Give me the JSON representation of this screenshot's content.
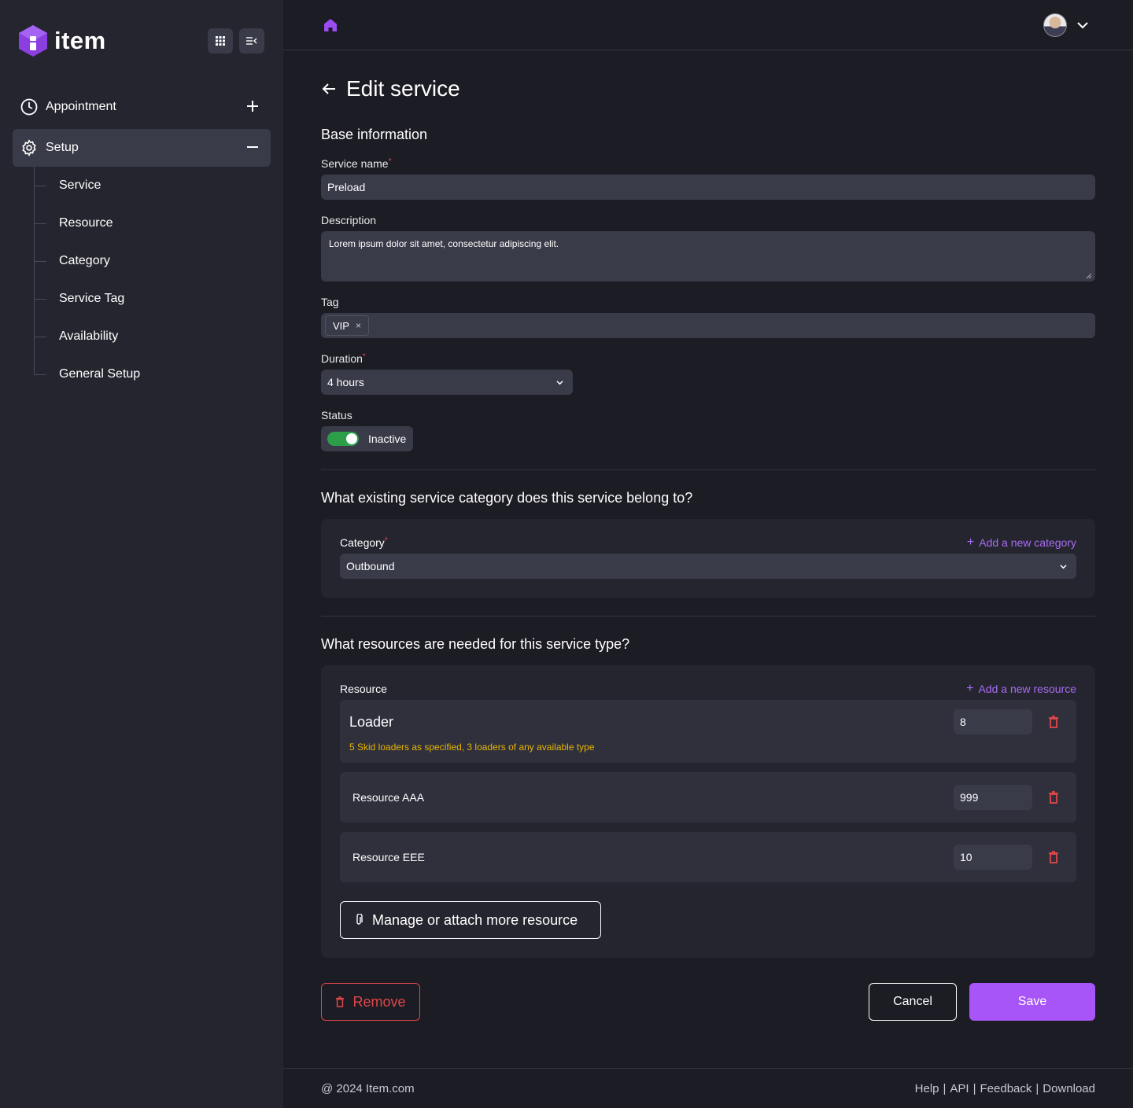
{
  "app": {
    "logo_text": "item"
  },
  "sidebar": {
    "items": [
      {
        "label": "Appointment",
        "action": "+"
      },
      {
        "label": "Setup",
        "action": "−"
      }
    ],
    "sub_items": [
      {
        "label": "Service"
      },
      {
        "label": "Resource"
      },
      {
        "label": "Category"
      },
      {
        "label": "Service Tag"
      },
      {
        "label": "Availability"
      },
      {
        "label": "General Setup"
      }
    ]
  },
  "page": {
    "title": "Edit service"
  },
  "base": {
    "section_title": "Base information",
    "service_name": {
      "label": "Service name",
      "required_mark": "*",
      "value": "Preload"
    },
    "description": {
      "label": "Description",
      "value": "Lorem ipsum dolor sit amet, consectetur adipiscing elit."
    },
    "tag": {
      "label": "Tag",
      "chips": [
        "VIP"
      ],
      "remove_glyph": "×"
    },
    "duration": {
      "label": "Duration",
      "required_mark": "*",
      "value": "4 hours"
    },
    "status": {
      "label": "Status",
      "value": "Inactive",
      "toggle_on": true
    }
  },
  "category_section": {
    "question": "What existing service category does this service belong to?",
    "label": "Category",
    "required_mark": "*",
    "add_link": "Add a new category",
    "value": "Outbound"
  },
  "resource_section": {
    "question": "What resources are needed for this service type?",
    "label": "Resource",
    "add_link": "Add a new resource",
    "rows": [
      {
        "name": "Loader",
        "note": "5 Skid loaders as specified, 3 loaders of any available type",
        "qty": "8"
      },
      {
        "name": "Resource AAA",
        "qty": "999"
      },
      {
        "name": "Resource EEE",
        "qty": "10"
      }
    ],
    "manage_button": "Manage or attach more resource"
  },
  "actions": {
    "remove": "Remove",
    "cancel": "Cancel",
    "save": "Save"
  },
  "footer": {
    "copyright": "@ 2024 Item.com",
    "links": [
      "Help",
      "API",
      "Feedback",
      "Download"
    ],
    "separator": "|"
  },
  "colors": {
    "accent": "#a855f7",
    "danger": "#e0474a",
    "toggle_on": "#2c9e4a",
    "note": "#e6b400"
  },
  "icons": [
    "logo-icon",
    "apps-grid-icon",
    "collapse-menu-icon",
    "clock-icon",
    "plus-icon",
    "gear-icon",
    "minus-icon",
    "home-icon",
    "chevron-down-icon",
    "arrow-left-icon",
    "close-icon",
    "trash-icon",
    "paperclip-icon"
  ]
}
